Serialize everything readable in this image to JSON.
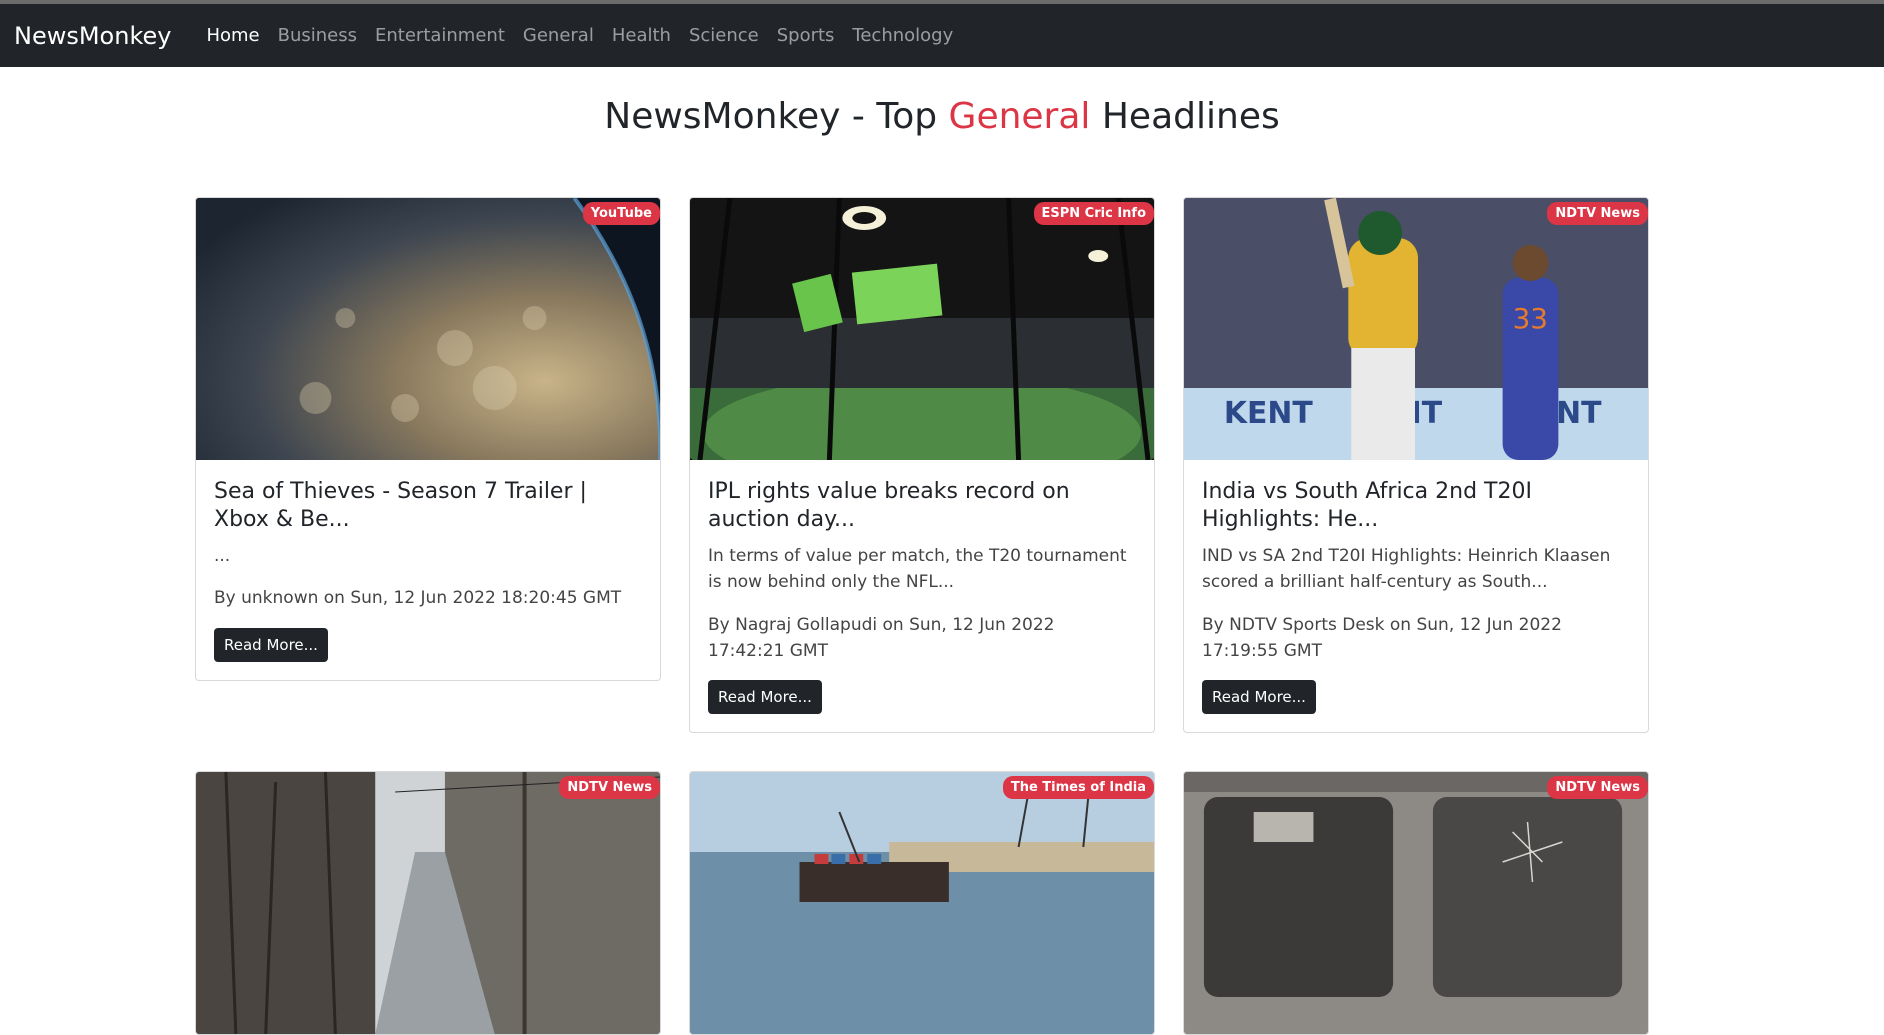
{
  "navbar": {
    "brand": "NewsMonkey",
    "items": [
      "Home",
      "Business",
      "Entertainment",
      "General",
      "Health",
      "Science",
      "Sports",
      "Technology"
    ]
  },
  "heading": {
    "prefix": "NewsMonkey - Top ",
    "accent": "General",
    "suffix": " Headlines"
  },
  "cards": [
    {
      "source": "YouTube",
      "title": "Sea of Thieves - Season 7 Trailer | Xbox & Be...",
      "description": "...",
      "meta": "By unknown on Sun, 12 Jun 2022 18:20:45 GMT",
      "button": "Read More..."
    },
    {
      "source": "ESPN Cric Info",
      "title": "IPL rights value breaks record on auction day...",
      "description": "In terms of value per match, the T20 tournament is now behind only the NFL...",
      "meta": "By Nagraj Gollapudi on Sun, 12 Jun 2022 17:42:21 GMT",
      "button": "Read More..."
    },
    {
      "source": "NDTV News",
      "title": "India vs South Africa 2nd T20I Highlights: He...",
      "description": "IND vs SA 2nd T20I Highlights: Heinrich Klaasen scored a brilliant half-century as South...",
      "meta": "By NDTV Sports Desk on Sun, 12 Jun 2022 17:19:55 GMT",
      "button": "Read More..."
    },
    {
      "source": "NDTV News"
    },
    {
      "source": "The Times of India"
    },
    {
      "source": "NDTV News"
    }
  ]
}
